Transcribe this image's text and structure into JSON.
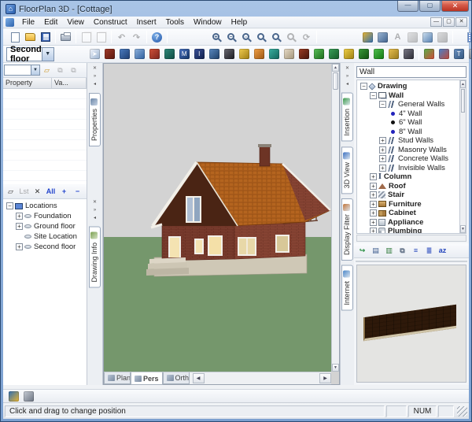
{
  "window": {
    "title": "FloorPlan 3D - [Cottage]",
    "minimize": "—",
    "maximize": "▢",
    "close": "✕"
  },
  "menubar": {
    "items": [
      "File",
      "Edit",
      "View",
      "Construct",
      "Insert",
      "Tools",
      "Window",
      "Help"
    ],
    "mdi": [
      "—",
      "▢",
      "✕"
    ]
  },
  "toolbar_standard": {
    "groups": [
      [
        {
          "name": "new-document-icon",
          "kind": "page"
        },
        {
          "name": "open-folder-icon",
          "kind": "folder"
        },
        {
          "name": "save-icon",
          "kind": "disk"
        }
      ],
      [
        {
          "name": "print-icon",
          "kind": "printer"
        }
      ],
      [
        {
          "name": "copy-icon",
          "kind": "copy",
          "gray": true
        },
        {
          "name": "paste-icon",
          "kind": "copy",
          "gray": true
        }
      ],
      [
        {
          "name": "undo-icon",
          "glyph": "↶",
          "gray": true
        },
        {
          "name": "redo-icon",
          "glyph": "↷",
          "gray": true
        }
      ],
      [
        {
          "name": "help-icon",
          "kind": "help",
          "label": "?"
        }
      ],
      [
        {
          "name": "zoom-in-icon",
          "kind": "mag",
          "label": "+"
        },
        {
          "name": "zoom-out-icon",
          "kind": "mag",
          "label": "−"
        },
        {
          "name": "zoom-window-icon",
          "kind": "mag",
          "label": "▫"
        },
        {
          "name": "zoom-previous-icon",
          "kind": "mag",
          "label": ""
        },
        {
          "name": "zoom-all-icon",
          "kind": "mag",
          "label": ""
        },
        {
          "name": "zoom-extents-icon",
          "kind": "mag",
          "label": "",
          "gray": true
        },
        {
          "name": "redraw-icon",
          "glyph": "⟳",
          "gray": true
        }
      ],
      [
        {
          "name": "walkthrough-icon",
          "c1": "#e8b430",
          "c2": "#2f6fb3"
        },
        {
          "name": "viewpoint-icon",
          "c1": "#9db8d6",
          "c2": "#40618c"
        },
        {
          "name": "text-icon",
          "glyph": "A",
          "gray": true
        },
        {
          "name": "dimension-icon",
          "c1": "#d8c890",
          "c2": "#8a7a40",
          "gray": true
        },
        {
          "name": "estimate-icon",
          "c1": "#cfe0f0",
          "c2": "#5580b0"
        },
        {
          "name": "materials-icon",
          "c1": "#c8b8a0",
          "c2": "#786858",
          "gray": true
        }
      ],
      [
        {
          "name": "grid-icon",
          "kind": "grid"
        },
        {
          "name": "person-blue-icon",
          "c1": "#8098c8",
          "c2": "#3a4f88",
          "label": "♟"
        },
        {
          "name": "person-green-icon",
          "c1": "#88c890",
          "c2": "#2f7a40",
          "label": "♟"
        }
      ]
    ]
  },
  "toolbar_construct": {
    "level_selector": "Second floor",
    "tools": [
      {
        "name": "select-tool-icon",
        "c1": "#f2f6fc",
        "c2": "#9ab2d0",
        "label": "➤"
      },
      {
        "name": "wall-tool-icon",
        "c1": "#a03828",
        "c2": "#5a180e"
      },
      {
        "name": "door-tool-icon",
        "c1": "#4a7cc0",
        "c2": "#1d3d70"
      },
      {
        "name": "window-tool-icon",
        "c1": "#8fb2dc",
        "c2": "#2c5d9e"
      },
      {
        "name": "opening-tool-icon",
        "c1": "#d05038",
        "c2": "#7b241c"
      },
      {
        "name": "roof-tool-icon",
        "c1": "#2f8a7a",
        "c2": "#0e4a42"
      },
      {
        "name": "framing-tool-icon",
        "c1": "#4a72c0",
        "c2": "#113366",
        "label": "M"
      },
      {
        "name": "column-tool-icon",
        "c1": "#3a5098",
        "c2": "#0e1f4a",
        "label": "I"
      },
      {
        "name": "room-tool-icon",
        "c1": "#5a8ac0",
        "c2": "#1c3d66"
      },
      {
        "name": "camera-tool-icon",
        "c1": "#6a6a72",
        "c2": "#1a1a20"
      },
      {
        "name": "furniture-tool-icon",
        "c1": "#f0cc50",
        "c2": "#9c7a10"
      },
      {
        "name": "lamp-tool-icon",
        "c1": "#f0a048",
        "c2": "#9c5510"
      },
      {
        "name": "ramp-tool-icon",
        "c1": "#3ab0a0",
        "c2": "#11635a"
      },
      {
        "name": "chair-tool-icon",
        "c1": "#e8dcc8",
        "c2": "#a09278"
      },
      {
        "name": "fireplace-tool-icon",
        "c1": "#9a3a22",
        "c2": "#44130a"
      },
      {
        "name": "plant-tool-icon",
        "c1": "#58c058",
        "c2": "#1c6a1c"
      },
      {
        "name": "stair-tool-icon",
        "c1": "#3aa05a",
        "c2": "#135a28"
      },
      {
        "name": "note-tool-icon",
        "c1": "#f0d048",
        "c2": "#9a7d10"
      },
      {
        "name": "fence-tool-icon",
        "c1": "#3a9a3a",
        "c2": "#0f4f0f"
      },
      {
        "name": "deck-tool-icon",
        "c1": "#50c050",
        "c2": "#117711"
      },
      {
        "name": "cabinet-tool-icon",
        "c1": "#e8c050",
        "c2": "#96781a"
      },
      {
        "name": "vehicle-tool-icon",
        "c1": "#7a7a88",
        "c2": "#2a2a33"
      }
    ],
    "tools2": [
      {
        "name": "roof-wizard-icon",
        "c1": "#58b048",
        "c2": "#d04838"
      },
      {
        "name": "terrain-icon",
        "c1": "#4a80c8",
        "c2": "#c04838"
      },
      {
        "name": "text-arrow-icon",
        "c1": "#6a90c0",
        "c2": "#32557e",
        "label": "T"
      },
      {
        "name": "sketch-icon",
        "c1": "#b0b8c4",
        "c2": "#5a6470",
        "label": "✎"
      },
      {
        "name": "page-icon",
        "c1": "#f4f6fa",
        "c2": "#9aa8bc"
      },
      {
        "name": "home-view-icon",
        "c1": "#c88850",
        "c2": "#6a3a1a",
        "label": "⌂"
      }
    ]
  },
  "left": {
    "properties": {
      "tab": "Properties",
      "combo_value": "",
      "buttons": [
        {
          "name": "add-property-icon",
          "label": "▱",
          "color": "#c89018"
        },
        {
          "name": "attach-icon",
          "label": "⧉",
          "gray": true
        },
        {
          "name": "detach-icon",
          "label": "⧉",
          "gray": true
        }
      ],
      "columns": [
        "Property",
        "Va..."
      ]
    },
    "drawing_info": {
      "tab": "Drawing Info",
      "buttons": [
        {
          "name": "box-filter-icon",
          "label": "▱"
        },
        {
          "name": "list-filter-icon",
          "label": "Lst",
          "gray": true
        },
        {
          "name": "delete-icon",
          "label": "✕"
        },
        {
          "name": "all-icon",
          "label": "All",
          "blue": true
        },
        {
          "name": "expand-all-icon",
          "label": "+",
          "blue": true
        },
        {
          "name": "collapse-all-icon",
          "label": "−",
          "blue": true
        }
      ],
      "tree": [
        {
          "label": "Locations",
          "depth": 0,
          "expand": "−",
          "icon": "t-pc"
        },
        {
          "label": "Foundation",
          "depth": 1,
          "expand": "+",
          "icon": "t-loc"
        },
        {
          "label": "Ground floor",
          "depth": 1,
          "expand": "+",
          "icon": "t-loc"
        },
        {
          "label": "Site Location",
          "depth": 1,
          "expand": "",
          "icon": "t-loc"
        },
        {
          "label": "Second floor",
          "depth": 1,
          "expand": "+",
          "icon": "t-loc"
        }
      ]
    }
  },
  "right": {
    "tabs": [
      "Insertion",
      "3D View",
      "Display Filter",
      "Internet"
    ],
    "tab_colors": [
      "#3a9a4a",
      "#3a6fc0",
      "#c0743a",
      "#4a86c8"
    ],
    "header_value": "Wall",
    "tree": [
      {
        "label": "Drawing",
        "depth": 0,
        "bold": true,
        "expand": "−",
        "icon": "t-draw"
      },
      {
        "label": "Wall",
        "depth": 1,
        "bold": true,
        "expand": "−",
        "icon": "t-wall"
      },
      {
        "label": "General Walls",
        "depth": 2,
        "expand": "−",
        "icon": "t-wtype"
      },
      {
        "label": "4\" Wall",
        "depth": 3,
        "bullet": "#2222bb"
      },
      {
        "label": "6\" Wall",
        "depth": 3,
        "bullet": "#111111"
      },
      {
        "label": "8\" Wall",
        "depth": 3,
        "bullet": "#2222bb"
      },
      {
        "label": "Stud Walls",
        "depth": 2,
        "expand": "+",
        "icon": "t-wtype"
      },
      {
        "label": "Masonry Walls",
        "depth": 2,
        "expand": "+",
        "icon": "t-wtype"
      },
      {
        "label": "Concrete Walls",
        "depth": 2,
        "expand": "+",
        "icon": "t-wtype"
      },
      {
        "label": "Invisible Walls",
        "depth": 2,
        "expand": "+",
        "icon": "t-wtype"
      },
      {
        "label": "Column",
        "depth": 1,
        "bold": true,
        "expand": "+",
        "icon": "t-col",
        "icon_text": "I"
      },
      {
        "label": "Roof",
        "depth": 1,
        "bold": true,
        "expand": "+",
        "icon": "t-roof"
      },
      {
        "label": "Stair",
        "depth": 1,
        "bold": true,
        "expand": "+",
        "icon": "t-stair"
      },
      {
        "label": "Furniture",
        "depth": 1,
        "bold": true,
        "expand": "+",
        "icon": "t-furn"
      },
      {
        "label": "Cabinet",
        "depth": 1,
        "bold": true,
        "expand": "+",
        "icon": "t-cab"
      },
      {
        "label": "Appliance",
        "depth": 1,
        "bold": true,
        "expand": "+",
        "icon": "t-appl"
      },
      {
        "label": "Plumbing",
        "depth": 1,
        "bold": true,
        "expand": "+",
        "icon": "t-plumb"
      }
    ],
    "tools": [
      {
        "name": "acquire-icon",
        "label": "↪",
        "color": "#1f8a3a"
      },
      {
        "name": "new-item-icon",
        "label": "▤",
        "color": "#3a5a8c"
      },
      {
        "name": "new-category-icon",
        "label": "▥",
        "color": "#2f7a3a"
      },
      {
        "name": "duplicate-icon",
        "label": "⧉",
        "color": "#5a6a80"
      },
      {
        "name": "list-view-icon",
        "label": "≡",
        "color": "#2244bb"
      },
      {
        "name": "detail-view-icon",
        "label": "≣",
        "color": "#2244bb"
      },
      {
        "name": "sort-icon",
        "label": "az",
        "color": "#2244bb"
      }
    ]
  },
  "viewport": {
    "tabs": [
      {
        "label": "Plan"
      },
      {
        "label": "Pers",
        "active": true
      },
      {
        "label": "Orth"
      }
    ],
    "colors": {
      "sky": "#d3d3d3",
      "ground": "#75976c",
      "roof": "#b4641f",
      "roof_dark": "#4a2414",
      "brick": "#7b3e2f",
      "brick_light": "#8a4635",
      "foundation": "#cfc8b6",
      "trim": "#f2efe8"
    }
  },
  "minibar": {
    "icons": [
      {
        "name": "walkthrough-player-icon",
        "c1": "#2f6fb3",
        "c2": "#e8b430"
      },
      {
        "name": "snapshot-icon",
        "c1": "#c8ced6",
        "c2": "#6a7280"
      }
    ]
  },
  "statusbar": {
    "message": "Click and drag to change position",
    "num_lock": "NUM"
  },
  "strip_buttons": [
    "✕",
    "»",
    "◂"
  ]
}
